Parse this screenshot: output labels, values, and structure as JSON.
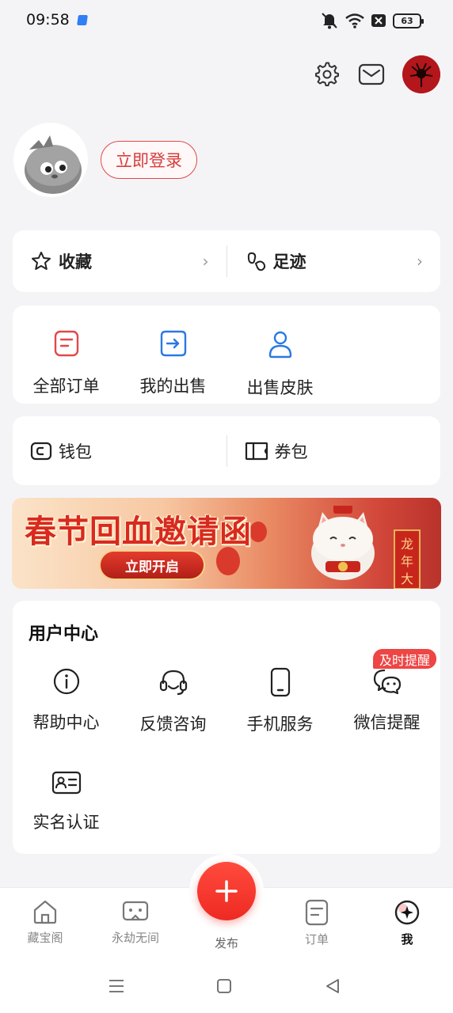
{
  "status": {
    "time": "09:58",
    "battery": "63"
  },
  "profile": {
    "login_label": "立即登录"
  },
  "shortcuts": {
    "favorites": "收藏",
    "history": "足迹"
  },
  "orders": [
    {
      "label": "全部订单",
      "icon": "order-list-icon"
    },
    {
      "label": "我的出售",
      "icon": "sell-arrow-icon"
    },
    {
      "label": "出售皮肤",
      "icon": "person-icon"
    }
  ],
  "wallet": {
    "wallet": "钱包",
    "coupons": "券包"
  },
  "banner": {
    "title": "春节回血邀请函",
    "button": "立即开启",
    "scroll_text": "龙年大"
  },
  "user_center": {
    "title": "用户中心",
    "badge": "及时提醒",
    "items": [
      {
        "label": "帮助中心",
        "icon": "info-icon"
      },
      {
        "label": "反馈咨询",
        "icon": "headset-icon"
      },
      {
        "label": "手机服务",
        "icon": "phone-icon"
      },
      {
        "label": "微信提醒",
        "icon": "wechat-icon"
      },
      {
        "label": "实名认证",
        "icon": "id-card-icon"
      }
    ]
  },
  "tabbar": {
    "items": [
      "藏宝阁",
      "永劫无间",
      "订单",
      "我"
    ],
    "publish": "发布"
  },
  "colors": {
    "accent": "#ee2a22",
    "badge": "#ee4545",
    "icon_red": "#e34848",
    "icon_blue": "#2a78e4"
  }
}
